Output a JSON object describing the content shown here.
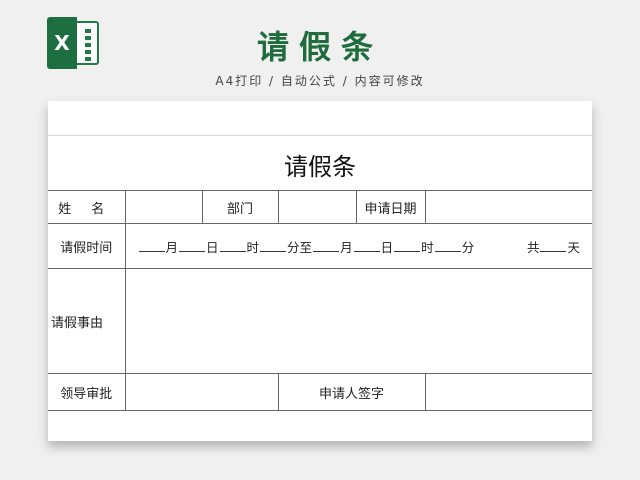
{
  "header": {
    "logo_letter": "X",
    "title": "请假条",
    "subtitle": "A4打印 / 自动公式 / 内容可修改"
  },
  "form": {
    "title": "请假条",
    "row1": {
      "name_label": "姓名",
      "dept_label": "部门",
      "date_label": "申请日期"
    },
    "row2": {
      "label": "请假时间",
      "month": "月",
      "day": "日",
      "hour": "时",
      "minute_to": "分至",
      "minute": "分",
      "total": "共",
      "days": "天"
    },
    "row3": {
      "label": "请假事由"
    },
    "row4": {
      "approve_label": "领导审批",
      "sign_label": "申请人签字"
    }
  }
}
